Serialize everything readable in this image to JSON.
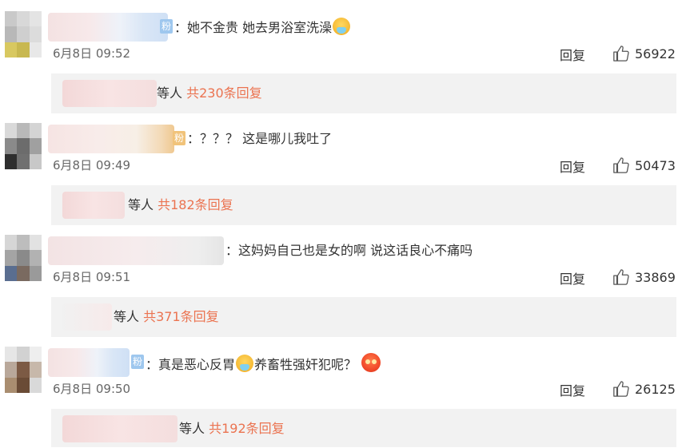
{
  "comments": [
    {
      "username_suffix": "粉",
      "text": "：她不金贵 她去男浴室洗澡",
      "emoji_after": "vomit-emoji",
      "time": "6月8日 09:52",
      "reply_label": "回复",
      "likes": "56922",
      "sub_suffix": "等人",
      "sub_count": "共230条回复"
    },
    {
      "username_suffix": "粉",
      "text": "：？？？ 这是哪儿我吐了",
      "time": "6月8日 09:49",
      "reply_label": "回复",
      "likes": "50473",
      "sub_suffix": "等人",
      "sub_count": "共182条回复"
    },
    {
      "username_suffix": "",
      "text": "：这妈妈自己也是女的啊 说这话良心不痛吗",
      "time": "6月8日 09:51",
      "reply_label": "回复",
      "likes": "33869",
      "sub_suffix": "等人",
      "sub_count": "共371条回复"
    },
    {
      "username_suffix": "粉",
      "text_part1": "：真是恶心反胃",
      "text_part2": "养畜牲强奸犯呢？",
      "time": "6月8日 09:50",
      "reply_label": "回复",
      "likes": "26125",
      "sub_suffix": "等人",
      "sub_count": "共192条回复"
    }
  ],
  "colors": {
    "link_orange": "#eb7350",
    "sub_bg": "#f2f2f2",
    "text": "#333333",
    "muted": "#666666"
  },
  "icons": [
    "thumbs-up-icon",
    "vomit-emoji",
    "angry-emoji"
  ]
}
